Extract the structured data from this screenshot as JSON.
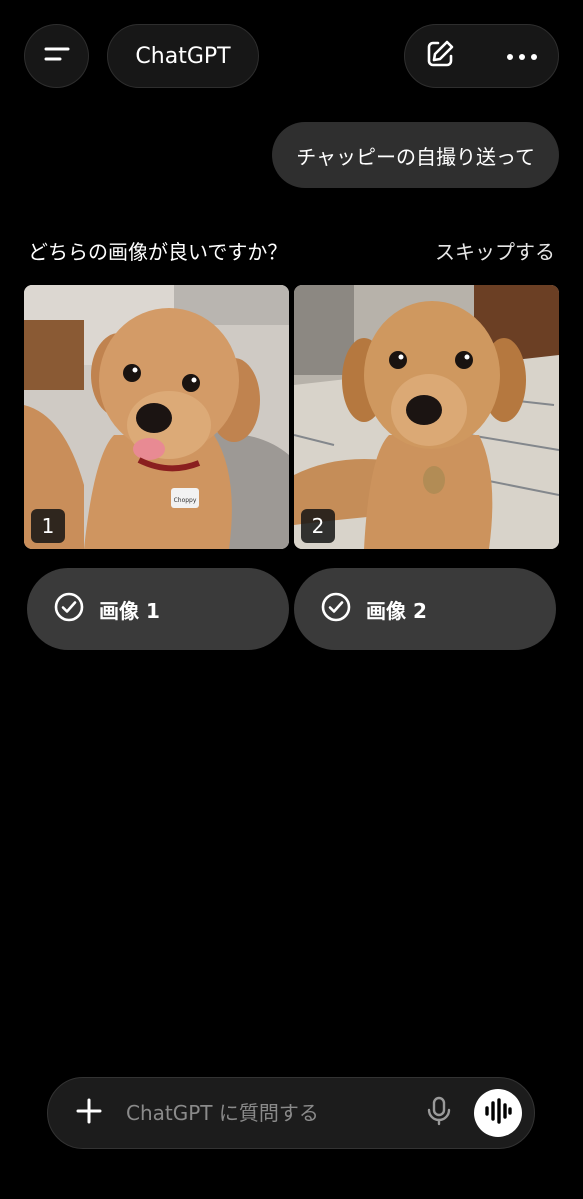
{
  "header": {
    "title": "ChatGPT",
    "menu_icon": "menu-icon",
    "new_chat_icon": "edit-icon",
    "more_icon": "more-icon"
  },
  "chat": {
    "user_message": "チャッピーの自撮り送って"
  },
  "comparison": {
    "question": "どちらの画像が良いですか？",
    "skip_label": "スキップする",
    "images": [
      {
        "badge": "1",
        "tag_text": "Choppy"
      },
      {
        "badge": "2"
      }
    ],
    "choices": [
      {
        "label": "画像 1",
        "icon": "check-circle-icon"
      },
      {
        "label": "画像 2",
        "icon": "check-circle-icon"
      }
    ]
  },
  "composer": {
    "placeholder": "ChatGPT に質問する",
    "value": "",
    "add_icon": "plus-icon",
    "mic_icon": "mic-icon",
    "voice_icon": "voice-mode-icon"
  },
  "colors": {
    "background": "#000000",
    "bubble": "#2f2f2f",
    "choice_button": "#3a3a3a"
  }
}
